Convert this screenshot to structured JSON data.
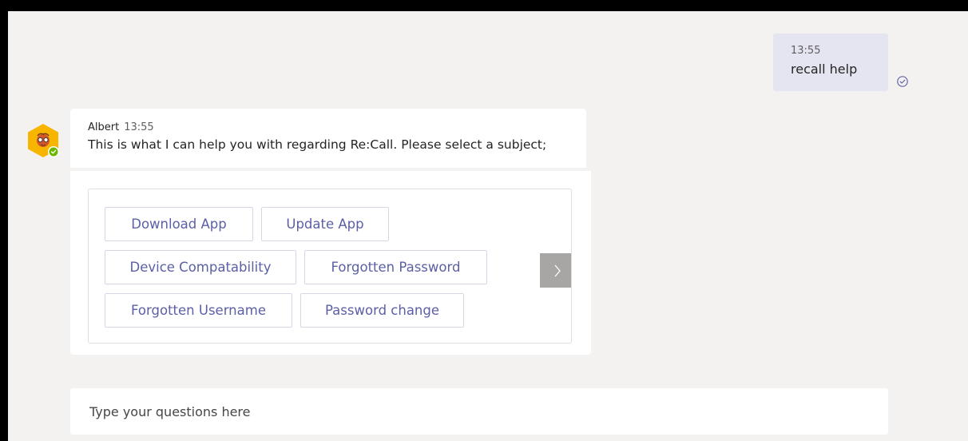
{
  "sent_message": {
    "time": "13:55",
    "text": "recall help",
    "status_icon": "read-check-icon"
  },
  "bot_message": {
    "author": "Albert",
    "time": "13:55",
    "text": "This is what I can help you with regarding Re:Call. Please select a subject;",
    "avatar_icon": "bot-avatar-icon",
    "presence": "available",
    "presence_color": "#6bb700"
  },
  "card": {
    "buttons": [
      {
        "label": "Download App"
      },
      {
        "label": "Update App"
      },
      {
        "label": "Device Compatability"
      },
      {
        "label": "Forgotten Password"
      },
      {
        "label": "Forgotten Username"
      },
      {
        "label": "Password change"
      }
    ],
    "next_icon": "chevron-right-icon"
  },
  "compose": {
    "placeholder": "Type your questions here"
  },
  "colors": {
    "accent": "#5b5fa6",
    "sent_bubble": "#e5e5f1",
    "background": "#f3f2f1"
  }
}
